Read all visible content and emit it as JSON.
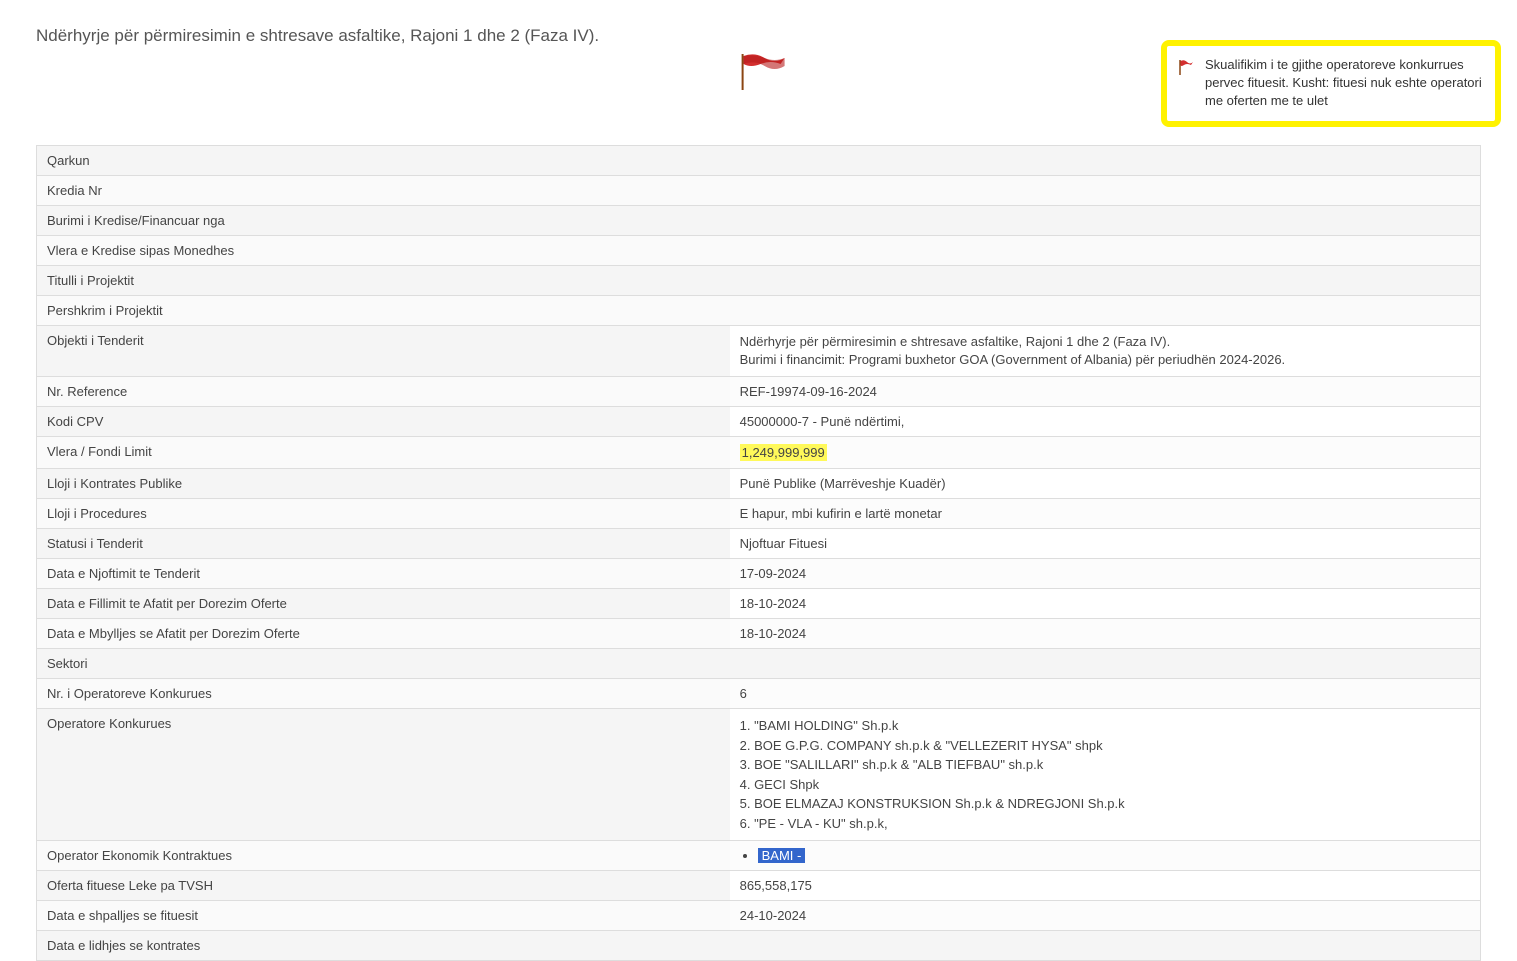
{
  "title": "Ndërhyrje për përmiresimin e shtresave asfaltike, Rajoni 1 dhe 2 (Faza IV).",
  "alert": {
    "text": "Skualifikim i te gjithe operatoreve konkurrues pervec fituesit. Kusht: fituesi nuk eshte operatori me oferten me te ulet"
  },
  "rows": {
    "qarkun": {
      "label": "Qarkun",
      "value": ""
    },
    "kredia_nr": {
      "label": "Kredia Nr",
      "value": ""
    },
    "burimi_kredise": {
      "label": "Burimi i Kredise/Financuar nga",
      "value": ""
    },
    "vlera_kredise": {
      "label": "Vlera e Kredise sipas Monedhes",
      "value": ""
    },
    "titulli_projektit": {
      "label": "Titulli i Projektit",
      "value": ""
    },
    "pershkrim": {
      "label": "Pershkrim i Projektit",
      "value": ""
    },
    "objekti": {
      "label": "Objekti i Tenderit",
      "line1": "Ndërhyrje për përmiresimin e shtresave asfaltike, Rajoni 1 dhe 2 (Faza IV).",
      "line2": "Burimi i financimit: Programi buxhetor GOA (Government of Albania) për periudhën 2024-2026."
    },
    "nr_reference": {
      "label": "Nr. Reference",
      "value": "REF-19974-09-16-2024"
    },
    "kodi_cpv": {
      "label": "Kodi CPV",
      "value": "45000000-7 - Punë ndërtimi,"
    },
    "vlera_fondi": {
      "label": "Vlera / Fondi Limit",
      "value": "1,249,999,999"
    },
    "lloji_kontrates": {
      "label": "Lloji i Kontrates Publike",
      "value": "Punë Publike (Marrëveshje Kuadër)"
    },
    "lloji_procedures": {
      "label": "Lloji i Procedures",
      "value": "E hapur, mbi kufirin e lartë monetar"
    },
    "statusi": {
      "label": "Statusi i Tenderit",
      "value": "Njoftuar Fituesi"
    },
    "data_njoftimit": {
      "label": "Data e Njoftimit te Tenderit",
      "value": "17-09-2024"
    },
    "data_fillimit": {
      "label": "Data e Fillimit te Afatit per Dorezim Oferte",
      "value": "18-10-2024"
    },
    "data_mbylljes": {
      "label": "Data e Mbylljes se Afatit per Dorezim Oferte",
      "value": "18-10-2024"
    },
    "sektori": {
      "label": "Sektori",
      "value": ""
    },
    "nr_operatoreve": {
      "label": "Nr. i Operatoreve Konkurues",
      "value": "6"
    },
    "operatore": {
      "label": "Operatore Konkurues",
      "items": [
        "1. \"BAMI HOLDING\" Sh.p.k",
        "2. BOE G.P.G. COMPANY sh.p.k & \"VELLEZERIT HYSA\" shpk",
        "3. BOE \"SALILLARI\" sh.p.k & \"ALB TIEFBAU\" sh.p.k",
        "4. GECI Shpk",
        "5. BOE ELMAZAJ KONSTRUKSION Sh.p.k & NDREGJONI Sh.p.k",
        "6. \"PE - VLA - KU\" sh.p.k,"
      ]
    },
    "operator_kontraktues": {
      "label": "Operator Ekonomik Kontraktues",
      "value": "BAMI  -"
    },
    "oferta_fituese": {
      "label": "Oferta fituese Leke pa TVSH",
      "value": "865,558,175"
    },
    "data_shpalljes": {
      "label": "Data e shpalljes se fituesit",
      "value": "24-10-2024"
    },
    "data_lidhjes": {
      "label": "Data e lidhjes se kontrates",
      "value": ""
    }
  }
}
